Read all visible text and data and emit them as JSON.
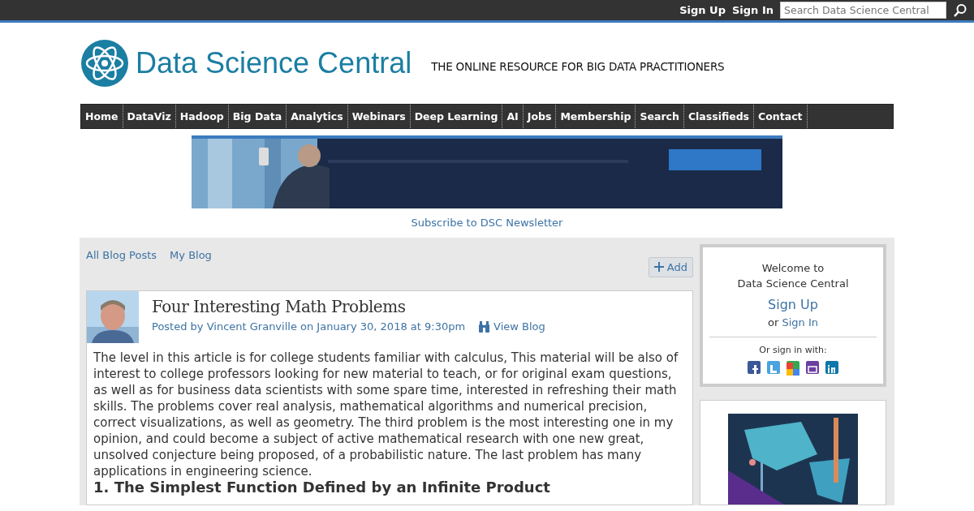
{
  "top_bar": {
    "links": [
      "Sign Up",
      "Sign In"
    ],
    "search": {
      "placeholder": "Search Data Science Central"
    }
  },
  "header": {
    "site_name": "Data Science Central",
    "tagline": "THE ONLINE RESOURCE FOR BIG DATA PRACTITIONERS"
  },
  "nav": [
    "Home",
    "DataViz",
    "Hadoop",
    "Big Data",
    "Analytics",
    "Webinars",
    "Deep Learning",
    "AI",
    "Jobs",
    "Membership",
    "Search",
    "Classifieds",
    "Contact"
  ],
  "newsletter_link": "Subscribe to DSC Newsletter",
  "blog_tabs": [
    "All Blog Posts",
    "My Blog"
  ],
  "add_button": "Add",
  "post": {
    "title": "Four Interesting Math Problems",
    "byline_prefix": "Posted by",
    "author": "Vincent Granville",
    "date": "on January 30, 2018 at 9:30pm",
    "view_blog": "View Blog",
    "body": "The level in this article is for college students familiar with calculus, This material will be also of interest to college professors looking for new material to teach, or for original exam questions, as well as for business data scientists with some spare time, interested in refreshing their math skills. The problems cover real analysis, mathematical algorithms and numerical precision, correct visualizations, as well as geometry. The third problem is the most interesting one in my opinion, and could become a subject of active mathematical research with one new great, unsolved conjecture being proposed, of a probabilistic nature. The last problem has many applications in engineering science.",
    "heading": "1. The Simplest Function Defined by an Infinite Product"
  },
  "sidebar": {
    "welcome": "Welcome to",
    "site": "Data Science Central",
    "sign_up": "Sign Up",
    "or": "or",
    "sign_in": "Sign In",
    "social_label": "Or sign in with:",
    "social": [
      {
        "color": "#3b5998",
        "kind": "f"
      },
      {
        "color": "#4aa3df",
        "kind": "t"
      },
      {
        "color": "#34a853",
        "kind": "g"
      },
      {
        "color": "#6b3fa0",
        "kind": "y"
      },
      {
        "color": "#0e76a8",
        "kind": "in"
      }
    ]
  }
}
